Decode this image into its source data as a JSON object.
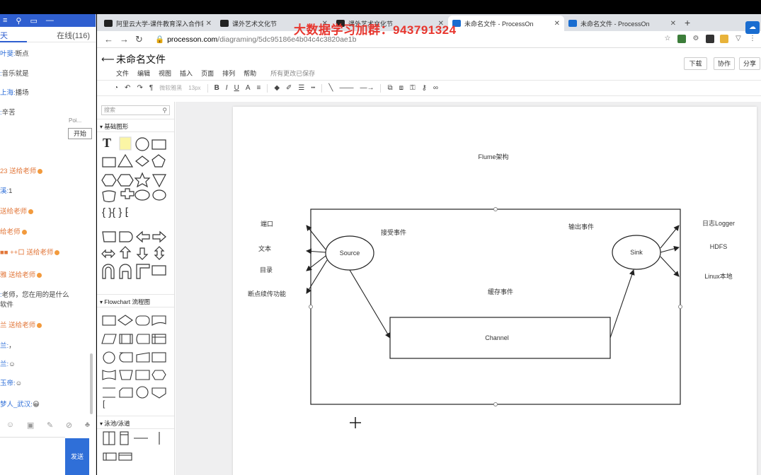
{
  "chat": {
    "header_title": "天",
    "tab_chat": "天",
    "tab_online": "在线(116)",
    "start_label": "开始",
    "poi_label": "Poi...",
    "send_label": "发送",
    "messages": [
      {
        "user": "叶斐:",
        "text": "断点"
      },
      {
        "user": ":",
        "text": "音乐就是"
      },
      {
        "user": "上海:",
        "text": "播场"
      },
      {
        "user": ":",
        "text": "辛苦"
      },
      {
        "gift": "23 送给老师"
      },
      {
        "user": "溪:",
        "text": "1"
      },
      {
        "gift": "送给老师"
      },
      {
        "gift": "给老师"
      },
      {
        "gift": "■■ ++口 送给老师"
      },
      {
        "gift": "雅 送给老师"
      },
      {
        "user": ":",
        "text": "老师，您在用的是什么"
      },
      {
        "user": "",
        "text": "软件"
      },
      {
        "gift": "兰 送给老师"
      },
      {
        "user": "兰:",
        "text": "，"
      },
      {
        "user": "兰:",
        "text": "☺"
      },
      {
        "user": "玉帝:",
        "text": "☺"
      },
      {
        "user": "梦人_武汉:",
        "text": "😀"
      }
    ]
  },
  "browser": {
    "tabs": [
      {
        "title": "阿里云大学-课件教育深入合作新",
        "active": false
      },
      {
        "title": "课外艺术文化节",
        "active": false
      },
      {
        "title": "课外艺术文化节",
        "active": false
      },
      {
        "title": "未命名文件 - ProcessOn",
        "active": true
      },
      {
        "title": "未命名文件 - ProcessOn",
        "active": false
      }
    ],
    "watermark": "大数据学习加群：943791324",
    "url_host": "processon.com",
    "url_path": "/diagraming/5dc95186e4b04c4c3820ae1b"
  },
  "app": {
    "doc_title": "未命名文件",
    "menu": [
      "文件",
      "编辑",
      "视图",
      "插入",
      "页面",
      "排列",
      "帮助"
    ],
    "save_status": "所有更改已保存",
    "download_label": "下载",
    "collab_label": "协作",
    "share_label": "分享",
    "font_select": "微软雅黑",
    "size_select": "13px",
    "shape_search_placeholder": "搜索",
    "categories": [
      "基础图形",
      "Flowchart 流程图",
      "泳池/泳道"
    ]
  },
  "diagram": {
    "title": "Flume架构",
    "source_label": "Source",
    "sink_label": "Sink",
    "channel_label": "Channel",
    "receive_event": "接受事件",
    "output_event": "输出事件",
    "cache_event": "缓存事件",
    "inputs": [
      "端口",
      "文本",
      "目录",
      "断点续传功能"
    ],
    "outputs": [
      "日志Logger",
      "HDFS",
      "Linux本地"
    ]
  }
}
